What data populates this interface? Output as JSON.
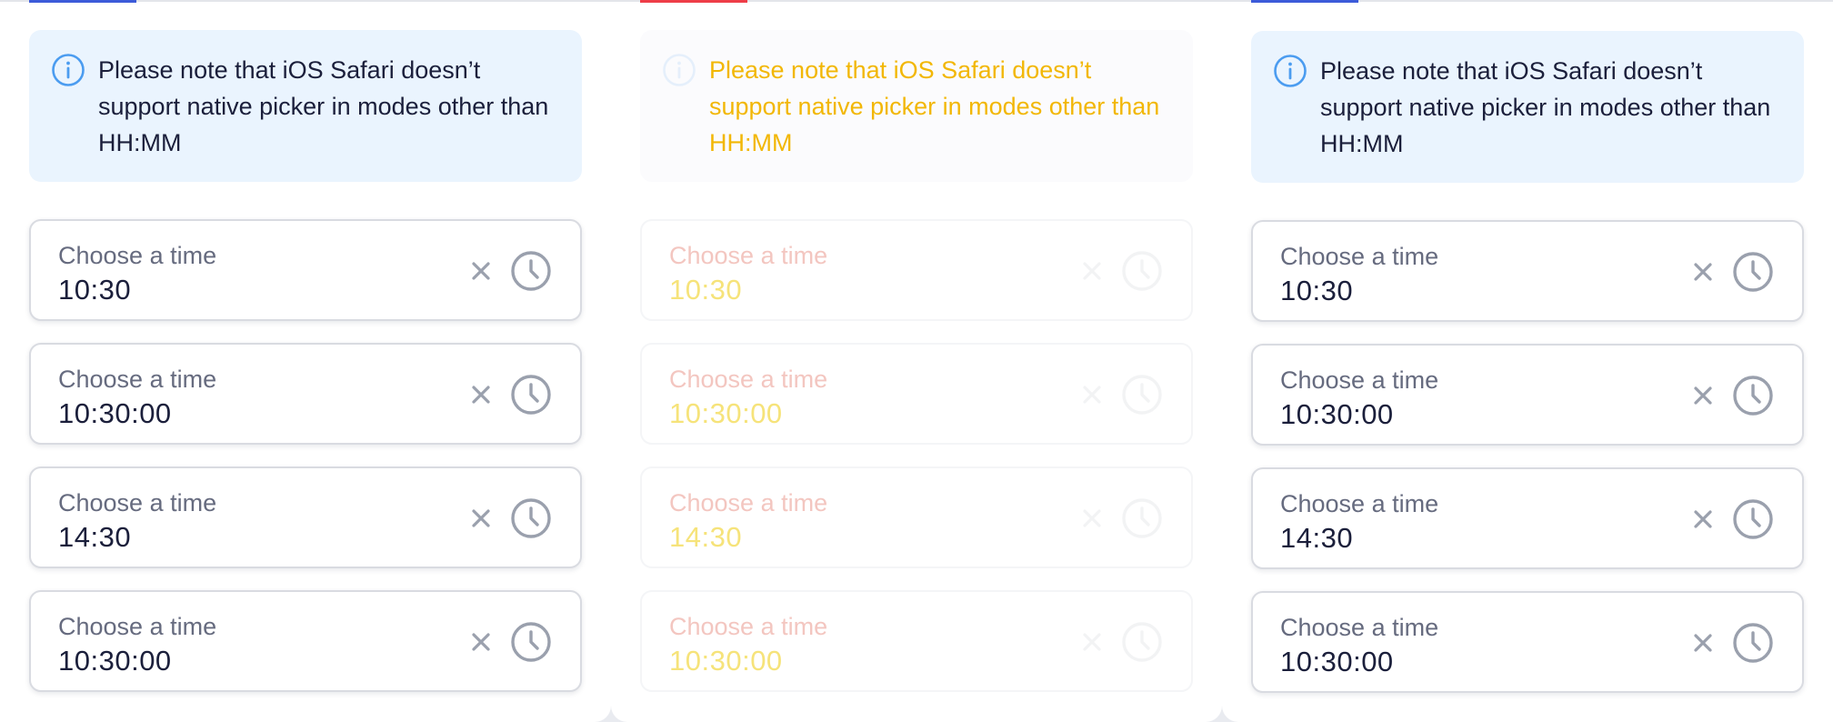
{
  "colors": {
    "tab_underline_left": "#3c5bd9",
    "tab_underline_middle": "#ee3d48",
    "tab_underline_right": "#3c5bd9",
    "note_background": "#eaf4fe",
    "info_icon": "#4b9cf0",
    "text_primary": "#1b1f3b",
    "text_label": "#666b7f",
    "icon_gray": "#9aa0ad"
  },
  "panels": [
    {
      "note": {
        "icon": "info-icon",
        "text": "Please note that iOS Safari doesn’t support native picker in modes other than HH:MM"
      },
      "fields": [
        {
          "label": "Choose a time",
          "value": "10:30",
          "clear_icon": "close-icon",
          "picker_icon": "clock-icon"
        },
        {
          "label": "Choose a time",
          "value": "10:30:00",
          "clear_icon": "close-icon",
          "picker_icon": "clock-icon"
        },
        {
          "label": "Choose a time",
          "value": "14:30",
          "clear_icon": "close-icon",
          "picker_icon": "clock-icon"
        },
        {
          "label": "Choose a time",
          "value": "10:30:00",
          "clear_icon": "close-icon",
          "picker_icon": "clock-icon"
        }
      ]
    },
    {
      "note": {
        "icon": "info-icon",
        "text": "Please note that iOS Safari doesn’t support native picker in modes other than HH:MM"
      },
      "fields": [
        {
          "label": "Choose a time",
          "value": "10:30",
          "clear_icon": "close-icon",
          "picker_icon": "clock-icon"
        },
        {
          "label": "Choose a time",
          "value": "10:30:00",
          "clear_icon": "close-icon",
          "picker_icon": "clock-icon"
        },
        {
          "label": "Choose a time",
          "value": "14:30",
          "clear_icon": "close-icon",
          "picker_icon": "clock-icon"
        },
        {
          "label": "Choose a time",
          "value": "10:30:00",
          "clear_icon": "close-icon",
          "picker_icon": "clock-icon"
        }
      ]
    },
    {
      "note": {
        "icon": "info-icon",
        "text": "Please note that iOS Safari doesn’t support native picker in modes other than HH:MM"
      },
      "fields": [
        {
          "label": "Choose a time",
          "value": "10:30",
          "clear_icon": "close-icon",
          "picker_icon": "clock-icon"
        },
        {
          "label": "Choose a time",
          "value": "10:30:00",
          "clear_icon": "close-icon",
          "picker_icon": "clock-icon"
        },
        {
          "label": "Choose a time",
          "value": "14:30",
          "clear_icon": "close-icon",
          "picker_icon": "clock-icon"
        },
        {
          "label": "Choose a time",
          "value": "10:30:00",
          "clear_icon": "close-icon",
          "picker_icon": "clock-icon"
        }
      ]
    }
  ]
}
